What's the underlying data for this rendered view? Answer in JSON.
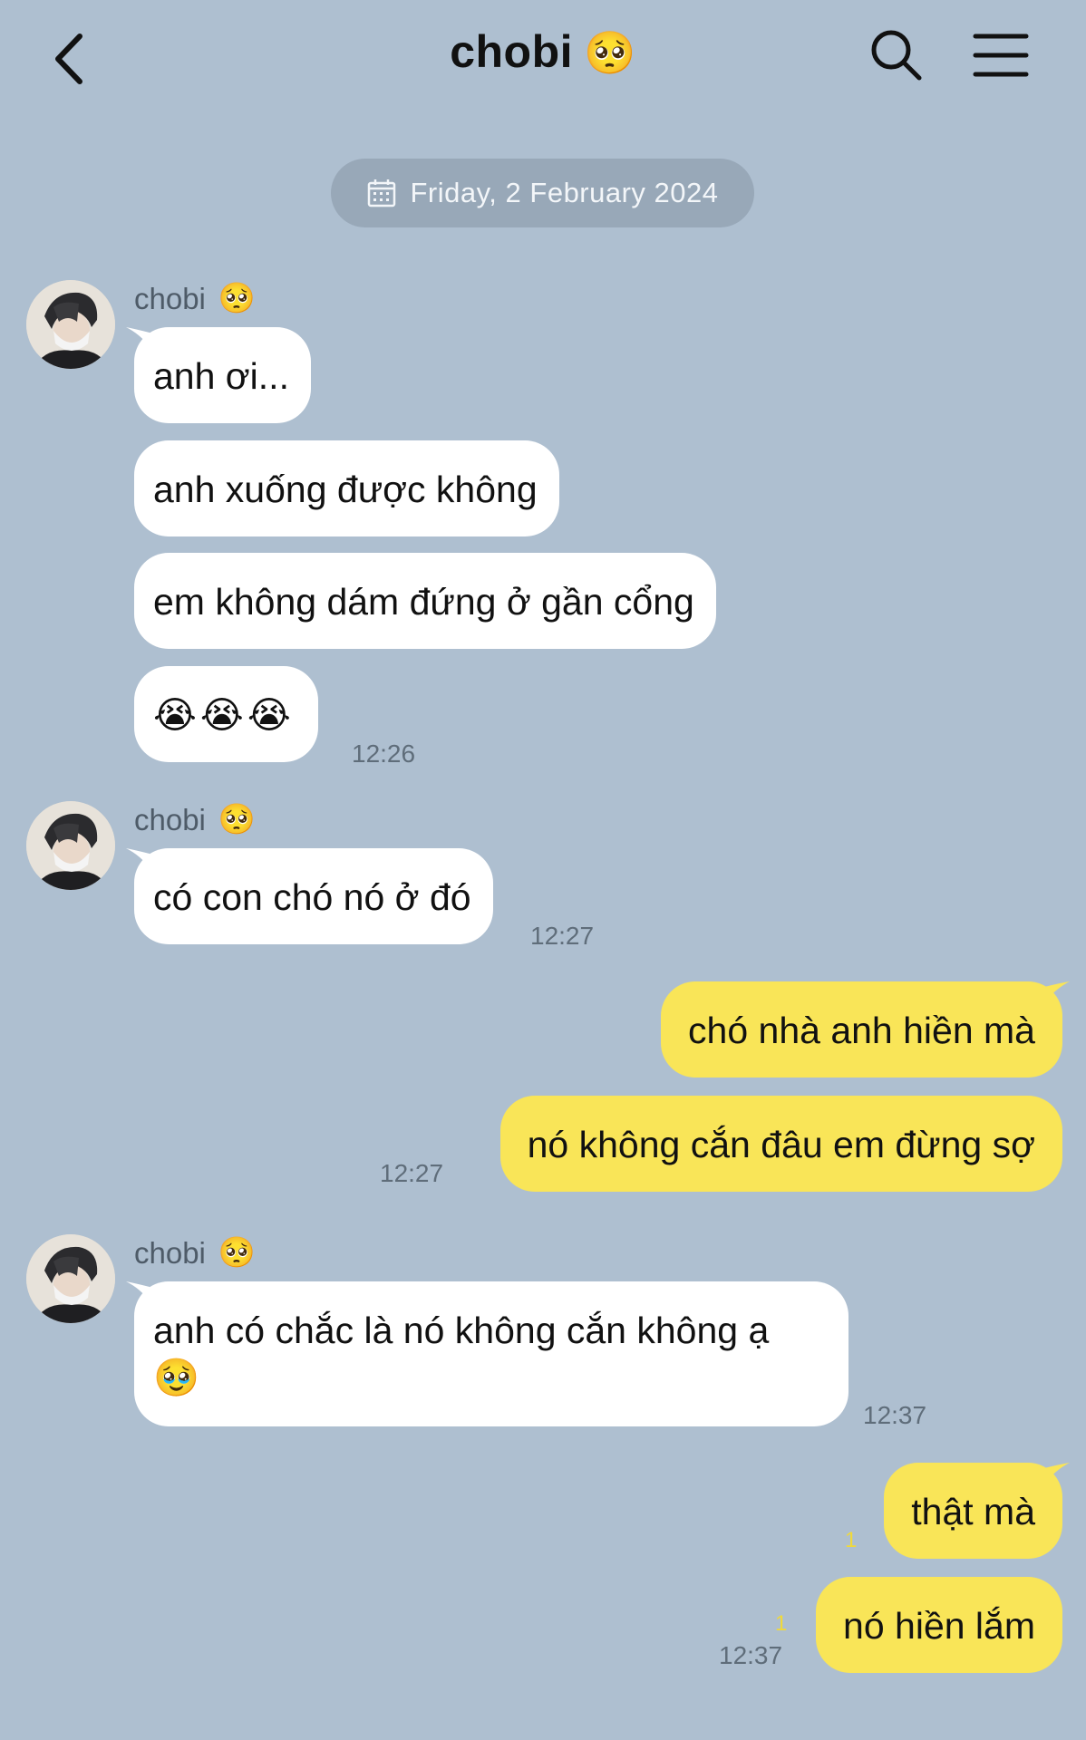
{
  "header": {
    "title": "chobi",
    "title_emoji": "🥺",
    "back_icon": "chevron-left-icon",
    "search_icon": "search-icon",
    "menu_icon": "hamburger-menu-icon"
  },
  "date_separator": "Friday, 2 February 2024",
  "sender": {
    "name": "chobi",
    "emoji": "🥺"
  },
  "messages": {
    "m1": "anh ơi...",
    "m2": "anh xuống được không",
    "m3": "em không dám đứng ở gần cổng",
    "m4": "😭😭😭",
    "t1": "12:26",
    "m5": "có con chó nó ở đó",
    "t2": "12:27",
    "m6": "chó nhà anh hiền mà",
    "m7": "nó không cắn đâu em đừng sợ",
    "t3": "12:27",
    "m8_line1": "anh có chắc là nó không cắn không ạ",
    "m8_line2": "🥹",
    "t4": "12:37",
    "m9": "thật mà",
    "r9": "1",
    "m10": "nó hiền lắm",
    "r10": "1",
    "t5": "12:37"
  },
  "colors": {
    "background": "#aebfd0",
    "incoming_bubble": "#ffffff",
    "outgoing_bubble": "#f9e558",
    "date_pill": "#98a8b8"
  }
}
